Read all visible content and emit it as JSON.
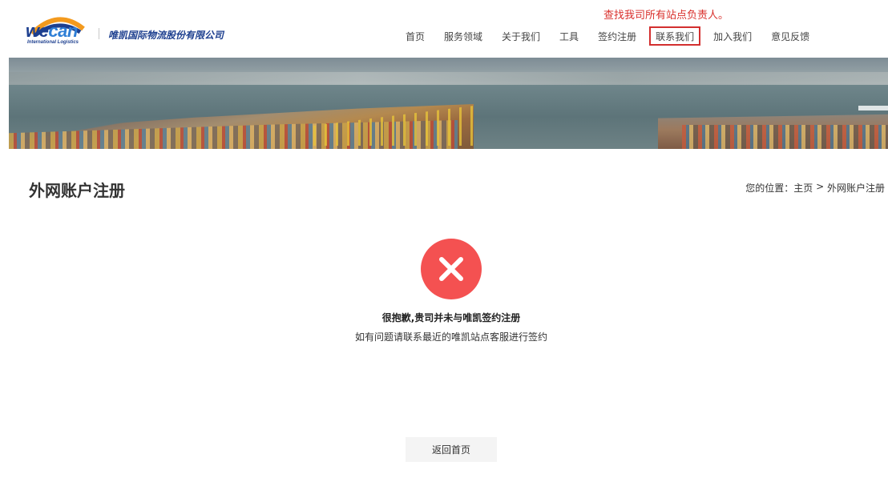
{
  "header": {
    "logo_text_1": "we",
    "logo_text_2": "can",
    "logo_subtitle": "International Logistics",
    "company_name": "唯凯国际物流股份有限公司",
    "notice": "查找我司所有站点负责人。"
  },
  "nav": {
    "items": [
      {
        "label": "首页"
      },
      {
        "label": "服务领域"
      },
      {
        "label": "关于我们"
      },
      {
        "label": "工具"
      },
      {
        "label": "签约注册"
      },
      {
        "label": "联系我们"
      },
      {
        "label": "加入我们"
      },
      {
        "label": "意见反馈"
      }
    ],
    "active_index": 5
  },
  "page": {
    "title": "外网账户注册",
    "breadcrumb": {
      "prefix": "您的位置：",
      "home": "主页",
      "separator": " > ",
      "current": "外网账户注册"
    }
  },
  "result": {
    "status": "error",
    "title": "很抱歉,贵司并未与唯凯签约注册",
    "description": "如有问题请联系最近的唯凯站点客服进行签约",
    "icon": "close-icon",
    "icon_color": "#f45151"
  },
  "actions": {
    "back_label": "返回首页"
  },
  "colors": {
    "brand_blue": "#1d3f8f",
    "logo_arc_orange": "#f39a1e",
    "notice_red": "#d9302c",
    "active_border": "#d32f2f"
  }
}
